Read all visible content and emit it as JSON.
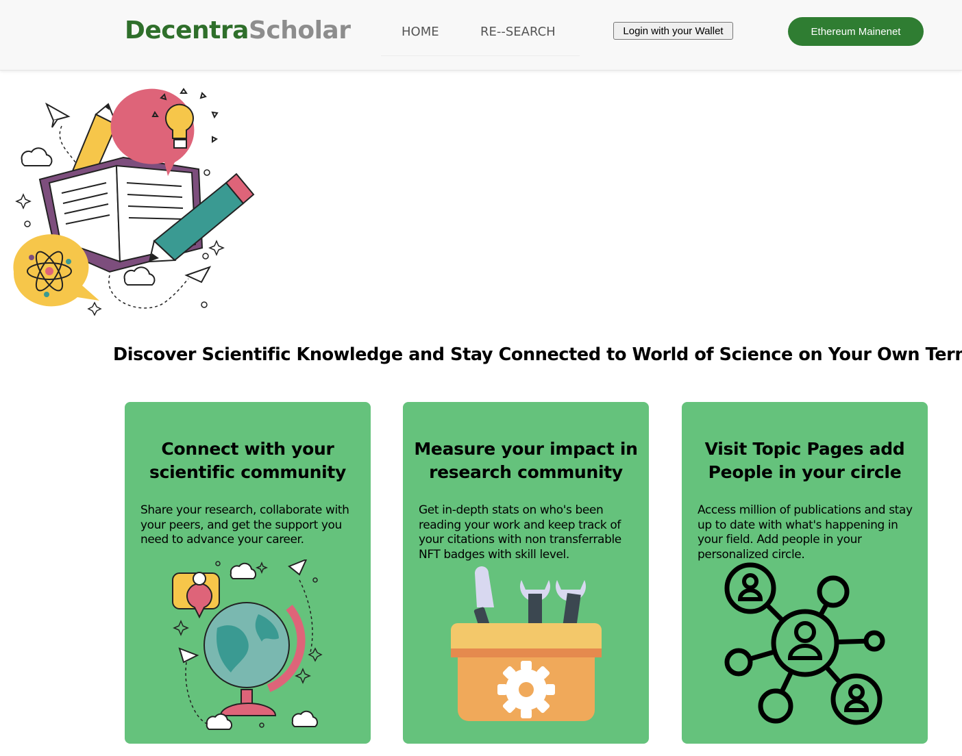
{
  "header": {
    "brand_part1": "Decentra",
    "brand_part2": "Scholar",
    "nav": {
      "home": "HOME",
      "research": "RE--SEARCH"
    },
    "login_label": "Login with your Wallet",
    "network_label": "Ethereum Mainenet"
  },
  "hero": {
    "illustration_icon": "education-illustration",
    "headline": "Discover Scientific Knowledge and Stay Connected to World of Science on Your Own Terms"
  },
  "cards": [
    {
      "title": "Connect with your scientific community",
      "text": "Share your research, collaborate with your peers, and get the support you need to advance your career.",
      "icon": "globe-icon"
    },
    {
      "title": "Measure your impact in research community",
      "text": "Get in-depth stats on who's been reading your work and keep track of your citations with non transferrable NFT badges with skill level.",
      "icon": "toolbox-icon"
    },
    {
      "title": "Visit Topic Pages add People in your circle",
      "text": "Access million of publications and stay up to date with what's happening in your field. Add people in your personalized circle.",
      "icon": "network-icon"
    }
  ],
  "colors": {
    "brand_green": "#2f6f2b",
    "brand_gray": "#8d8d8d",
    "card_green": "#65c27c",
    "network_button": "#2f7d32"
  }
}
